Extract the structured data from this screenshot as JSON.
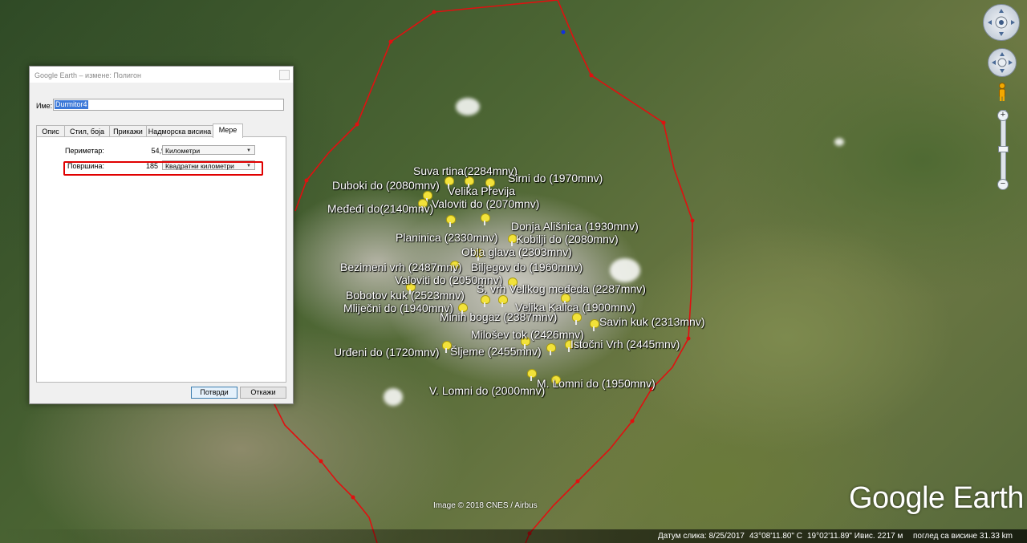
{
  "map": {
    "peaks": [
      {
        "label": "Suva rtina(2284mnv)"
      },
      {
        "label": "Sirni do (1970mnv)"
      },
      {
        "label": "Duboki do (2080mnv)"
      },
      {
        "label": "Velika Previja"
      },
      {
        "label": "Valoviti do (2070mnv)"
      },
      {
        "label": "Međeđi do(2140mnv)"
      },
      {
        "label": "Donja Ališnica (1930mnv)"
      },
      {
        "label": "Planinica (2330mnv)"
      },
      {
        "label": "Kobilji do (2080mnv)"
      },
      {
        "label": "Obla glava (2303mnv)"
      },
      {
        "label": "Bezimeni vrh (2487mnv)"
      },
      {
        "label": "Biljegov do (1960mnv)"
      },
      {
        "label": "Valoviti do (2050mnv)"
      },
      {
        "label": "S. vrh Velikog međeda (2287mnv)"
      },
      {
        "label": "Bobotov kuk (2523mnv)"
      },
      {
        "label": "Mliječni do (1940mnv)"
      },
      {
        "label": "Velika Kalica (1900mnv)"
      },
      {
        "label": "Minin bogaz (2387mnv)"
      },
      {
        "label": "Savin kuk (2313mnv)"
      },
      {
        "label": "Milošev tok (2426mnv)"
      },
      {
        "label": "Istočni Vrh (2445mnv)"
      },
      {
        "label": "Urđeni do (1720mnv)"
      },
      {
        "label": "Šljeme (2455mnv)"
      },
      {
        "label": "M. Lomni do (1950mnv)"
      },
      {
        "label": "V. Lomni do (2000mnv)"
      }
    ],
    "credit": "Image © 2018 CNES / Airbus",
    "logo": "Google Earth",
    "polygon_color": "#e01010"
  },
  "statusbar": {
    "image_date": "Датум слика: 8/25/2017",
    "lat": "43°08'11.80\" С",
    "lon": "19°02'11.89\" И",
    "elev": "вис. 2217 м",
    "eye_alt": "поглед са висине  31.33 km"
  },
  "dialog": {
    "title": "Google Earth – измене: Полигон",
    "name_label": "Име:",
    "name_value": "Durmitor4",
    "tabs": [
      "Опис",
      "Стил, боја",
      "Прикажи",
      "Надморска висина",
      "Мере"
    ],
    "active_tab": "Мере",
    "perimeter_label": "Периметар:",
    "perimeter_value": "54,9",
    "perimeter_unit": "Километри",
    "area_label": "Површина:",
    "area_value": "185",
    "area_unit": "Квадратни километри",
    "ok_label": "Потврди",
    "cancel_label": "Откажи"
  },
  "controls": {
    "zoom_in": "+",
    "zoom_out": "−"
  }
}
